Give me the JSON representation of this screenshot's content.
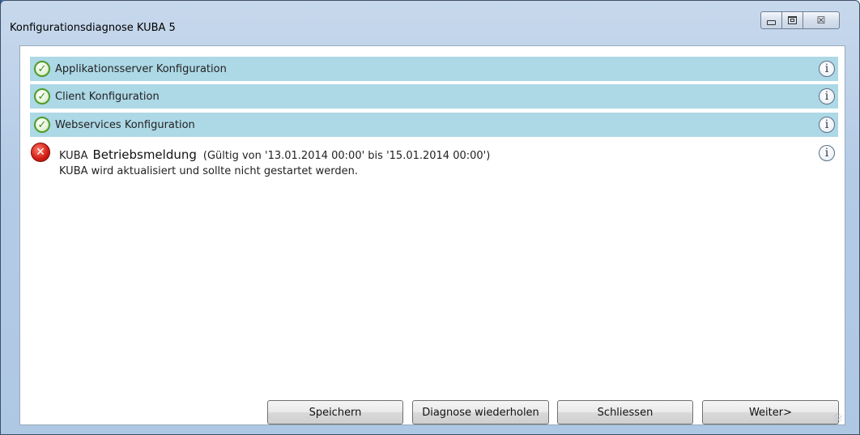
{
  "window": {
    "title": "Konfigurationsdiagnose KUBA 5",
    "caption_buttons": [
      "minimize",
      "maximize",
      "close"
    ],
    "close_glyph": "☒"
  },
  "checks": [
    {
      "label": "Applikationsserver Konfiguration",
      "status": "ok",
      "icon": "check-circle-icon"
    },
    {
      "label": "Client Konfiguration",
      "status": "ok",
      "icon": "check-circle-icon"
    },
    {
      "label": "Webservices Konfiguration",
      "status": "ok",
      "icon": "check-circle-icon"
    }
  ],
  "error": {
    "source": "KUBA",
    "heading": "Betriebsmeldung",
    "validity": "(Gültig von '13.01.2014 00:00' bis '15.01.2014 00:00')",
    "message": "KUBA wird aktualisiert und sollte nicht gestartet werden.",
    "status": "error",
    "icon": "error-x-icon"
  },
  "icons": {
    "ok_glyph": "✓",
    "info_glyph": "i",
    "error_glyph": "✕"
  },
  "buttons": {
    "save": "Speichern",
    "rerun": "Diagnose wiederholen",
    "close": "Schliessen",
    "next": "Weiter>"
  },
  "colors": {
    "row_highlight": "#add8e6",
    "ok_green": "#4f9b2c",
    "error_red": "#d01c14",
    "title_bar": "#b4cbe6"
  }
}
